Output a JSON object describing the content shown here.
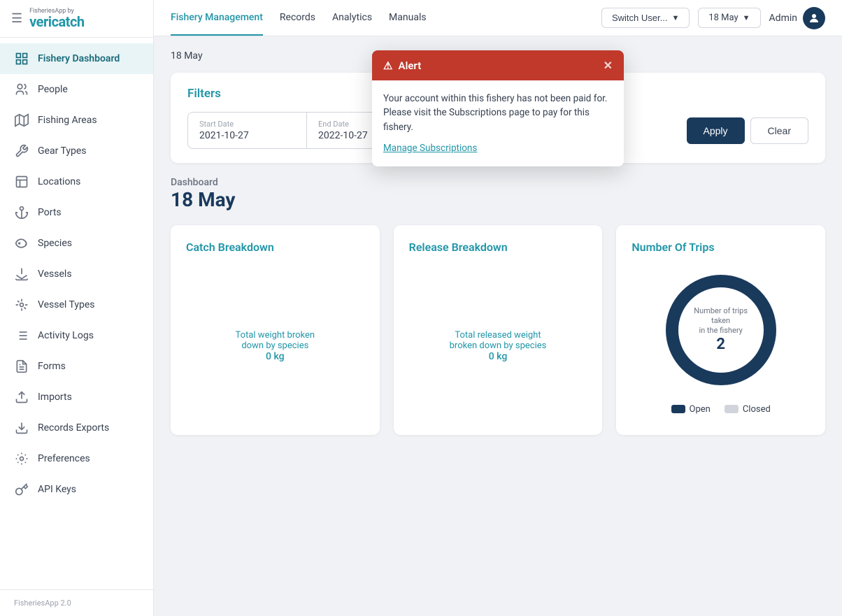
{
  "app": {
    "logo_small": "FisheriesApp by",
    "logo_main_part1": "veri",
    "logo_main_part2": "catch",
    "version": "FisheriesApp 2.0"
  },
  "topnav": {
    "links": [
      {
        "id": "fishery-management",
        "label": "Fishery Management",
        "active": true
      },
      {
        "id": "records",
        "label": "Records",
        "active": false
      },
      {
        "id": "analytics",
        "label": "Analytics",
        "active": false
      },
      {
        "id": "manuals",
        "label": "Manuals",
        "active": false
      }
    ],
    "switch_user_label": "Switch User...",
    "date_label": "18 May",
    "admin_label": "Admin"
  },
  "sub_date": "18 May",
  "alert": {
    "title": "Alert",
    "message": "Your account within this fishery has not been paid for. Please visit the Subscriptions page to pay for this fishery.",
    "link_label": "Manage Subscriptions"
  },
  "filters": {
    "title": "Filters",
    "start_date_label": "Start Date",
    "start_date_value": "2021-10-27",
    "end_date_label": "End Date",
    "end_date_value": "2022-10-27",
    "apply_label": "Apply",
    "clear_label": "Clear"
  },
  "dashboard": {
    "label": "Dashboard",
    "date": "18 May"
  },
  "cards": {
    "catch_breakdown": {
      "title": "Catch Breakdown",
      "empty_line1": "Total weight broken",
      "empty_line2": "down by species",
      "empty_value": "0 kg"
    },
    "release_breakdown": {
      "title": "Release Breakdown",
      "empty_line1": "Total released weight",
      "empty_line2": "broken down by species",
      "empty_value": "0 kg"
    },
    "number_of_trips": {
      "title": "Number Of Trips",
      "center_label_line1": "Number of trips taken",
      "center_label_line2": "in the fishery",
      "center_value": "2",
      "legend_open": "Open",
      "legend_closed": "Closed"
    }
  },
  "sidebar": {
    "items": [
      {
        "id": "fishery-dashboard",
        "label": "Fishery Dashboard",
        "icon": "chart",
        "active": true
      },
      {
        "id": "people",
        "label": "People",
        "icon": "people",
        "active": false
      },
      {
        "id": "fishing-areas",
        "label": "Fishing Areas",
        "icon": "map",
        "active": false
      },
      {
        "id": "gear-types",
        "label": "Gear Types",
        "icon": "wrench",
        "active": false
      },
      {
        "id": "locations",
        "label": "Locations",
        "icon": "building",
        "active": false
      },
      {
        "id": "ports",
        "label": "Ports",
        "icon": "anchor",
        "active": false
      },
      {
        "id": "species",
        "label": "Species",
        "icon": "fish",
        "active": false
      },
      {
        "id": "vessels",
        "label": "Vessels",
        "icon": "vessel",
        "active": false
      },
      {
        "id": "vessel-types",
        "label": "Vessel Types",
        "icon": "vessel-type",
        "active": false
      },
      {
        "id": "activity-logs",
        "label": "Activity Logs",
        "icon": "list",
        "active": false
      },
      {
        "id": "forms",
        "label": "Forms",
        "icon": "form",
        "active": false
      },
      {
        "id": "imports",
        "label": "Imports",
        "icon": "import",
        "active": false
      },
      {
        "id": "records-exports",
        "label": "Records Exports",
        "icon": "export",
        "active": false
      },
      {
        "id": "preferences",
        "label": "Preferences",
        "icon": "gear",
        "active": false
      },
      {
        "id": "api-keys",
        "label": "API Keys",
        "icon": "key",
        "active": false
      }
    ]
  },
  "donut": {
    "open_pct": 100,
    "closed_pct": 0,
    "total": 2,
    "color_open": "#1a3a5c",
    "color_closed": "#d1d5db"
  }
}
